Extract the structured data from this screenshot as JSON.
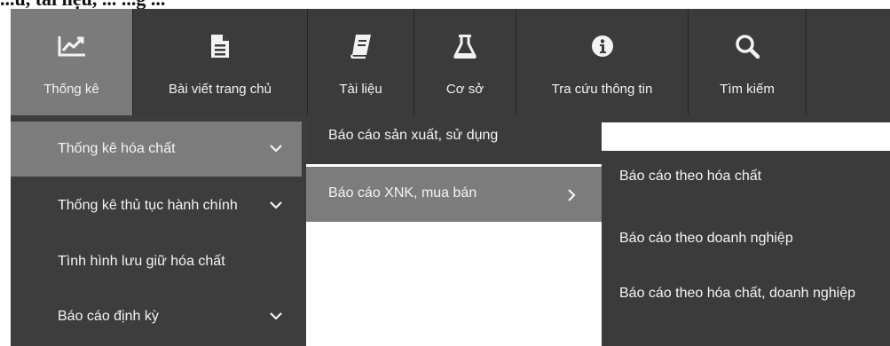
{
  "caption": "...u, tài liệu, ... ...g ...",
  "nav": [
    {
      "label": "Thống kê",
      "icon": "line-chart-icon"
    },
    {
      "label": "Bài viết trang chủ",
      "icon": "document-icon"
    },
    {
      "label": "Tài liệu",
      "icon": "book-icon"
    },
    {
      "label": "Cơ sở",
      "icon": "flask-icon"
    },
    {
      "label": "Tra cứu thông tin",
      "icon": "info-icon"
    },
    {
      "label": "Tìm kiếm",
      "icon": "search-icon"
    }
  ],
  "menu_level1": [
    {
      "label": "Thống kê hóa chất",
      "has_submenu": true,
      "active": true
    },
    {
      "label": "Thống kê thủ tục hành chính",
      "has_submenu": true,
      "active": false
    },
    {
      "label": "Tình hình lưu giữ hóa chất",
      "has_submenu": false,
      "active": false
    },
    {
      "label": "Báo cáo định kỳ",
      "has_submenu": true,
      "active": false
    }
  ],
  "menu_level2": [
    {
      "label": "Báo cáo sản xuất, sử dụng",
      "has_submenu": false,
      "active": false
    },
    {
      "label": "Báo cáo XNK, mua bán",
      "has_submenu": true,
      "active": true
    }
  ],
  "menu_level3": [
    {
      "label": "Báo cáo theo hóa chất"
    },
    {
      "label": "Báo cáo theo doanh nghiệp"
    },
    {
      "label": "Báo cáo theo hóa chất, doanh nghiệp"
    }
  ],
  "colors": {
    "nav_bg": "#3b3b3b",
    "active_bg": "#7b7b7b",
    "text": "#f2f2f2"
  }
}
